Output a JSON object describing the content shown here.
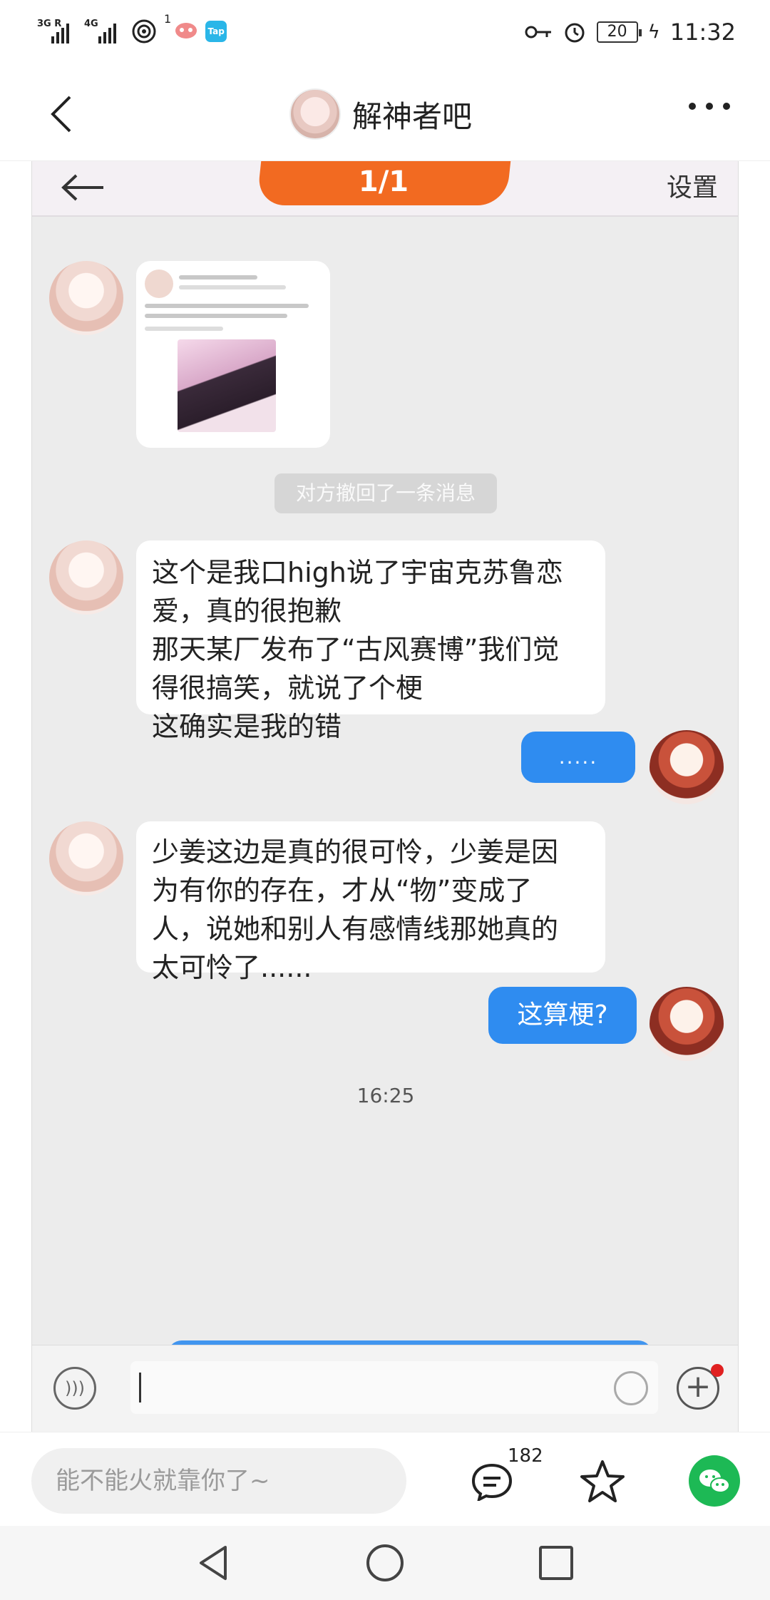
{
  "status_bar": {
    "sim1_label": "3G R",
    "sim2_label": "4G",
    "notification_count": "1",
    "tap_badge": "Tap",
    "battery": "20",
    "time": "11:32"
  },
  "header": {
    "title": "解神者吧"
  },
  "screenshot": {
    "page_indicator": "1/1",
    "settings_label": "设置",
    "recall_notice": "对方撤回了一条消息",
    "messages": [
      {
        "side": "left",
        "text": "这个是我口high说了宇宙克苏鲁恋\n爱，真的很抱歉\n那天某厂发布了“古风赛博”我们觉\n得很搞笑，就说了个梗\n这确实是我的错"
      },
      {
        "side": "right",
        "text": "....."
      },
      {
        "side": "left",
        "text": "少姜这边是真的很可怜，少姜是因\n为有你的存在，才从“物”变成了\n人，说她和别人有感情线那她真的\n太可怜了......"
      },
      {
        "side": "right",
        "text": "这算梗?"
      }
    ],
    "timestamp": "16:25"
  },
  "reply_bar": {
    "placeholder": "能不能火就靠你了~",
    "comment_count": "182"
  },
  "colors": {
    "accent_blue": "#2f8cf0",
    "orange": "#f26a21",
    "wechat_green": "#1db955"
  }
}
